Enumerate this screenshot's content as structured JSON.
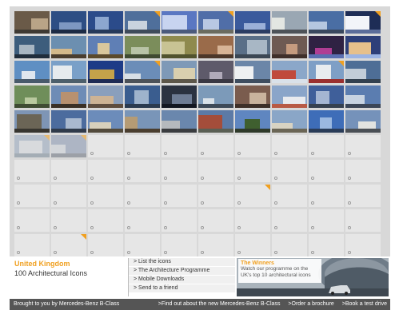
{
  "info": {
    "region": "United Kingdom",
    "subtitle": "100 Architectural Icons"
  },
  "menu": [
    "> List the icons",
    "> The Architecture Programme",
    "> Mobile Downloads",
    "> Send to a friend"
  ],
  "winners": {
    "heading": "The Winners",
    "body": "Watch our programme on the UK's top 10 architectural icons"
  },
  "footer": {
    "brought": "Brought to you by Mercedes-Benz B-Class",
    "links": [
      ">Find out about the new Mercedes-Benz B-Class",
      ">Order a brochure",
      ">Book a test drive"
    ]
  },
  "colors": {
    "accent": "#f0a020",
    "footer_bg": "#555555",
    "frame_bg": "#d8d8d8",
    "empty_tile": "#e6e6e6"
  },
  "grid": {
    "rows": 10,
    "cols": 10,
    "photo_tiles": [
      {
        "id": 1,
        "colors": [
          "#6a5a48",
          "#b9a487",
          "#3f3a33"
        ]
      },
      {
        "id": 2,
        "colors": [
          "#2d4e84",
          "#7d97c1",
          "#1c2b44"
        ]
      },
      {
        "id": 3,
        "colors": [
          "#2b4b8a",
          "#8ca6cf",
          "#263a5b"
        ]
      },
      {
        "id": 4,
        "colors": [
          "#4f6f9b",
          "#c9d3de",
          "#3e4b5b"
        ],
        "flag": true
      },
      {
        "id": 5,
        "colors": [
          "#5a77c2",
          "#c8d4f0",
          "#4b5a7c"
        ]
      },
      {
        "id": 6,
        "colors": [
          "#506ea8",
          "#b8c8e3",
          "#6b6b5f"
        ],
        "flag": true
      },
      {
        "id": 7,
        "colors": [
          "#3a5a9c",
          "#9bb0d8",
          "#2b3d63"
        ]
      },
      {
        "id": 8,
        "colors": [
          "#9aa7b3",
          "#e3e6e2",
          "#4d5258"
        ]
      },
      {
        "id": 9,
        "colors": [
          "#4a6ea4",
          "#b5c7e0",
          "#39485e"
        ]
      },
      {
        "id": 10,
        "colors": [
          "#1e2d56",
          "#f2f4f9",
          "#5b6d9a"
        ],
        "flag": true
      },
      {
        "id": 11,
        "colors": [
          "#3d5d7c",
          "#a8b6c2",
          "#202d3b"
        ]
      },
      {
        "id": 12,
        "colors": [
          "#6c8fb0",
          "#d3b98b",
          "#4a3d2e"
        ]
      },
      {
        "id": 13,
        "colors": [
          "#5f7fb5",
          "#d9c79c",
          "#5b4a2c"
        ]
      },
      {
        "id": 14,
        "colors": [
          "#7b8d5b",
          "#b8c3a7",
          "#3f4a31"
        ]
      },
      {
        "id": 15,
        "colors": [
          "#8f8a4e",
          "#c8c394",
          "#51532e"
        ]
      },
      {
        "id": 16,
        "colors": [
          "#9a6b4a",
          "#d7b496",
          "#4c3729"
        ]
      },
      {
        "id": 17,
        "colors": [
          "#5a6f87",
          "#a8b7c5",
          "#3b4754"
        ]
      },
      {
        "id": 18,
        "colors": [
          "#6e5a53",
          "#c59b7f",
          "#3f2f2a"
        ]
      },
      {
        "id": 19,
        "colors": [
          "#2f2243",
          "#b03d93",
          "#5a6fb1"
        ]
      },
      {
        "id": 20,
        "colors": [
          "#2d3f79",
          "#e6c08b",
          "#9bb4e4"
        ]
      },
      {
        "id": 21,
        "colors": [
          "#5f8fc3",
          "#dfe6ee",
          "#485a6b"
        ]
      },
      {
        "id": 22,
        "colors": [
          "#7aa0c8",
          "#e6ebee",
          "#4d5f6b"
        ]
      },
      {
        "id": 23,
        "colors": [
          "#1d3b87",
          "#c4a24a",
          "#1f2c55"
        ]
      },
      {
        "id": 24,
        "colors": [
          "#6b8db8",
          "#d8dfe6",
          "#4c5259"
        ],
        "flag": true
      },
      {
        "id": 25,
        "colors": [
          "#7e99b7",
          "#d9cfae",
          "#5d574a"
        ]
      },
      {
        "id": 26,
        "colors": [
          "#5e5a6a",
          "#b0aab9",
          "#3a3842"
        ]
      },
      {
        "id": 27,
        "colors": [
          "#6b86a8",
          "#eef0f2",
          "#3e4d5f"
        ]
      },
      {
        "id": 28,
        "colors": [
          "#8ba7c9",
          "#c04a3b",
          "#d9e1e9"
        ]
      },
      {
        "id": 29,
        "colors": [
          "#7e9fc6",
          "#e8ecef",
          "#9a2f2f"
        ],
        "flag": true
      },
      {
        "id": 30,
        "colors": [
          "#4e6e96",
          "#c2cdd8",
          "#33414f"
        ]
      },
      {
        "id": 31,
        "colors": [
          "#6f8e5a",
          "#b9c99f",
          "#3f4c33"
        ]
      },
      {
        "id": 32,
        "colors": [
          "#6e8cb6",
          "#b89170",
          "#3a3026"
        ]
      },
      {
        "id": 33,
        "colors": [
          "#8a9fbc",
          "#cdb394",
          "#5e4d3e"
        ]
      },
      {
        "id": 34,
        "colors": [
          "#3a5d8f",
          "#9eb3cc",
          "#2a3a4f"
        ]
      },
      {
        "id": 35,
        "colors": [
          "#2b3240",
          "#6e7c94",
          "#121620"
        ]
      },
      {
        "id": 36,
        "colors": [
          "#7c9ab9",
          "#d9e1e8",
          "#3e4a58"
        ]
      },
      {
        "id": 37,
        "colors": [
          "#7a5c4e",
          "#c9b39d",
          "#3d2f28"
        ]
      },
      {
        "id": 38,
        "colors": [
          "#8aa5c9",
          "#e8eaee",
          "#b85a45"
        ]
      },
      {
        "id": 39,
        "colors": [
          "#3f5f9a",
          "#a5b6d2",
          "#36414f"
        ]
      },
      {
        "id": 40,
        "colors": [
          "#5b7db0",
          "#c7d3e1",
          "#3b4657"
        ]
      },
      {
        "id": 41,
        "colors": [
          "#7e95b5",
          "#6b6556",
          "#37352f"
        ]
      },
      {
        "id": 42,
        "colors": [
          "#4c6c9e",
          "#a9b9cf",
          "#2f3a4a"
        ]
      },
      {
        "id": 43,
        "colors": [
          "#6c8cba",
          "#d8d1bc",
          "#524a3b"
        ]
      },
      {
        "id": 44,
        "colors": [
          "#7995b8",
          "#b59b74",
          "#4a3e2f"
        ]
      },
      {
        "id": 45,
        "colors": [
          "#6a87ad",
          "#b5b9bd",
          "#3a3c3f"
        ]
      },
      {
        "id": 46,
        "colors": [
          "#5c7aa6",
          "#a44d3a",
          "#5a5f54"
        ]
      },
      {
        "id": 47,
        "colors": [
          "#5f86c0",
          "#3f5f2f",
          "#2f3a2a"
        ]
      },
      {
        "id": 48,
        "colors": [
          "#8aa6c7",
          "#d8d3c2",
          "#6a6555"
        ]
      },
      {
        "id": 49,
        "colors": [
          "#3e6db8",
          "#9bb8e0",
          "#2a3c58"
        ]
      },
      {
        "id": 50,
        "colors": [
          "#7592ba",
          "#e2e3e0",
          "#4a4f55"
        ]
      },
      {
        "id": 51,
        "colors": [
          "#9aaac0",
          "#d8dde2",
          "#7b8a9a"
        ],
        "flag": true,
        "faded": true
      },
      {
        "id": 52,
        "colors": [
          "#8a9ab4",
          "#d0d6dc",
          "#6c7480"
        ],
        "flag": true,
        "faded": true
      }
    ],
    "extra_flags": [
      77,
      92
    ]
  }
}
